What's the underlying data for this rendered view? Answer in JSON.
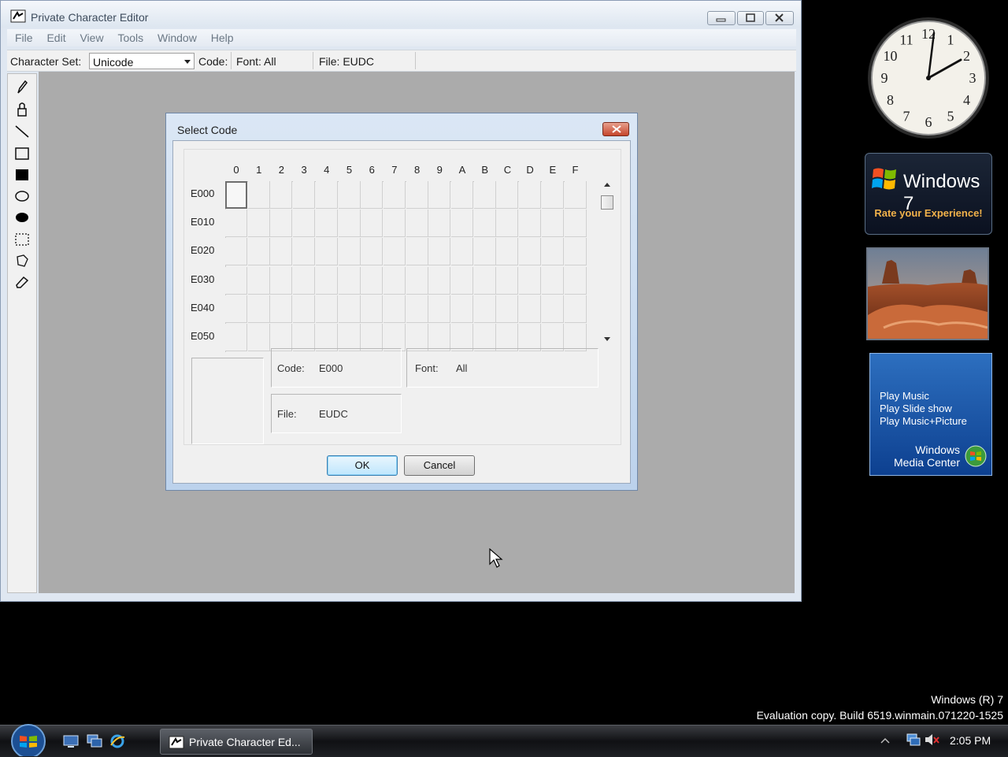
{
  "window": {
    "title": "Private Character Editor",
    "menu": [
      "File",
      "Edit",
      "View",
      "Tools",
      "Window",
      "Help"
    ],
    "toolbar": {
      "charset_label": "Character Set:",
      "charset_value": "Unicode",
      "code_label": "Code:",
      "font_text": "Font: All",
      "file_text": "File: EUDC"
    },
    "tools": [
      "pencil-icon",
      "brush-icon",
      "line-icon",
      "hollow-rectangle-icon",
      "filled-rectangle-icon",
      "hollow-ellipse-icon",
      "filled-ellipse-icon",
      "rectangular-selection-icon",
      "freeform-selection-icon",
      "eraser-icon"
    ]
  },
  "dialog": {
    "title": "Select Code",
    "columns": [
      "0",
      "1",
      "2",
      "3",
      "4",
      "5",
      "6",
      "7",
      "8",
      "9",
      "A",
      "B",
      "C",
      "D",
      "E",
      "F"
    ],
    "rows": [
      "E000",
      "E010",
      "E020",
      "E030",
      "E040",
      "E050"
    ],
    "selected_cell": "E000",
    "code_label": "Code:",
    "code_value": "E000",
    "font_label": "Font:",
    "font_value": "All",
    "file_label": "File:",
    "file_value": "EUDC",
    "ok_label": "OK",
    "cancel_label": "Cancel"
  },
  "gadgets": {
    "clock_numerals": [
      "12",
      "1",
      "2",
      "3",
      "4",
      "5",
      "6",
      "7",
      "8",
      "9",
      "10",
      "11"
    ],
    "windows7": {
      "title": "Windows 7",
      "subtitle": "Rate your Experience!"
    },
    "media_center": {
      "items": [
        "Play Music",
        "Play Slide show",
        "Play Music+Picture"
      ],
      "brand_line1": "Windows",
      "brand_line2": "Media Center"
    }
  },
  "watermark": {
    "line1": "Windows (R) 7",
    "line2": "Evaluation copy. Build 6519.winmain.071220-1525"
  },
  "taskbar": {
    "task_label": "Private Character Ed...",
    "clock": "2:05 PM"
  },
  "colors": {
    "desktop": "#000000",
    "workspace": "#ababab",
    "dialog_frame": "#bcd2ec",
    "close_button": "#c5452b",
    "ok_button": "#bee6fd"
  }
}
